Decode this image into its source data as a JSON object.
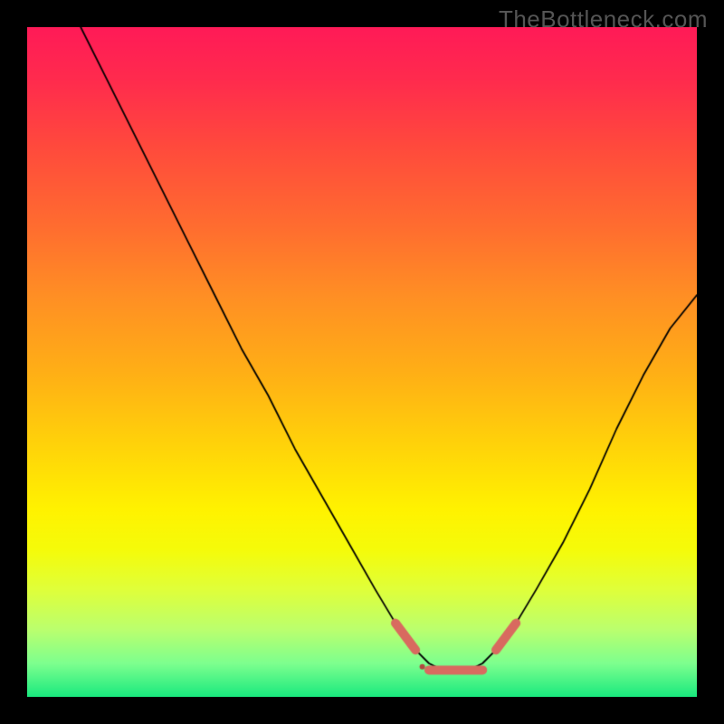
{
  "watermark": "TheBottleneck.com",
  "chart_data": {
    "type": "line",
    "title": "",
    "xlabel": "",
    "ylabel": "",
    "xlim": [
      0,
      100
    ],
    "ylim": [
      0,
      100
    ],
    "series": [
      {
        "name": "curve",
        "color": "#000000",
        "width": 1.8,
        "x": [
          8,
          12,
          16,
          20,
          24,
          28,
          32,
          36,
          40,
          44,
          48,
          52,
          55,
          58,
          60,
          62,
          64,
          66,
          68,
          70,
          73,
          76,
          80,
          84,
          88,
          92,
          96,
          100
        ],
        "y": [
          100,
          92,
          84,
          76,
          68,
          60,
          52,
          45,
          37,
          30,
          23,
          16,
          11,
          7,
          5,
          4,
          4,
          4,
          5,
          7,
          11,
          16,
          23,
          31,
          40,
          48,
          55,
          60
        ]
      },
      {
        "name": "highlight",
        "color": "#d86a5f",
        "width": 10,
        "cap": "round",
        "segments": [
          {
            "x": [
              55,
              58
            ],
            "y": [
              11,
              7
            ]
          },
          {
            "x": [
              60,
              68
            ],
            "y": [
              4,
              4
            ]
          },
          {
            "x": [
              70,
              73
            ],
            "y": [
              7,
              11
            ]
          }
        ]
      }
    ]
  }
}
